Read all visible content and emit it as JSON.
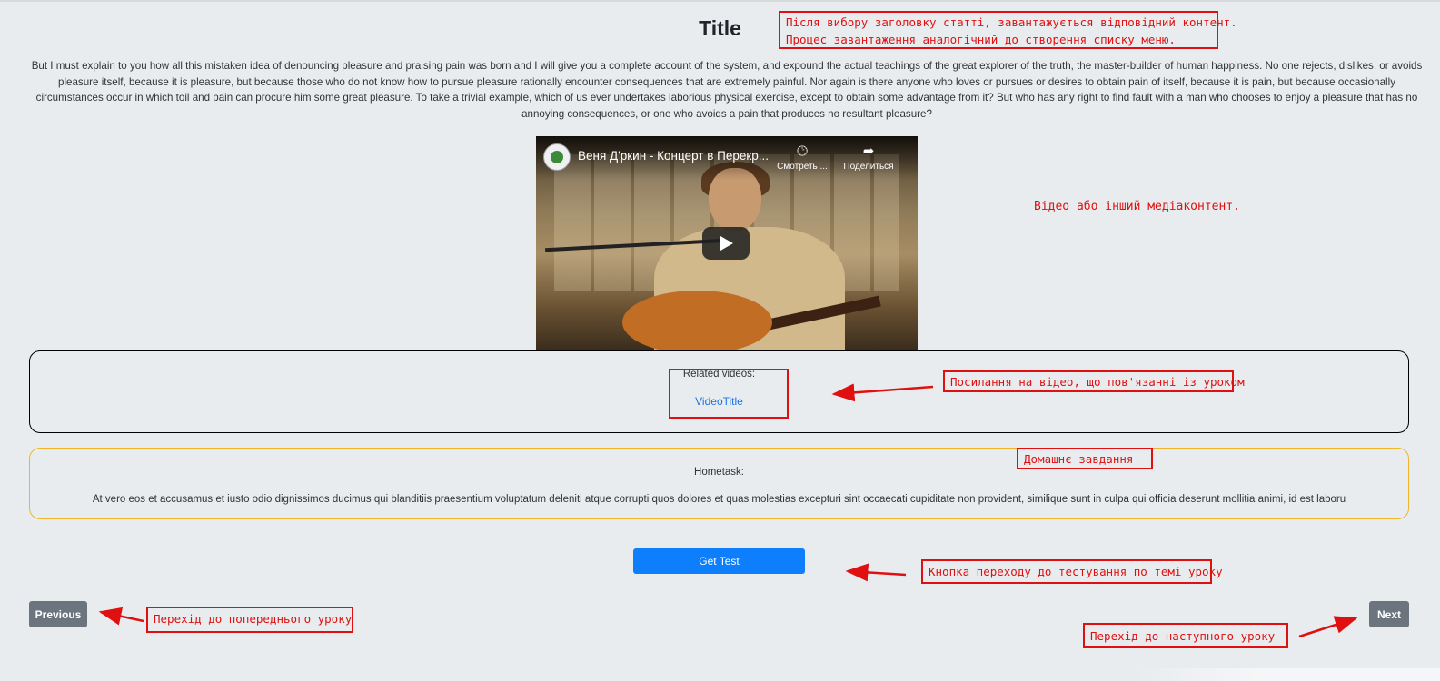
{
  "article": {
    "title": "Title",
    "body": "But I must explain to you how all this mistaken idea of denouncing pleasure and praising pain was born and I will give you a complete account of the system, and expound the actual teachings of the great explorer of the truth, the master-builder of human happiness. No one rejects, dislikes, or avoids pleasure itself, because it is pleasure, but because those who do not know how to pursue pleasure rationally encounter consequences that are extremely painful. Nor again is there anyone who loves or pursues or desires to obtain pain of itself, because it is pain, but because occasionally circumstances occur in which toil and pain can procure him some great pleasure. To take a trivial example, which of us ever undertakes laborious physical exercise, except to obtain some advantage from it? But who has any right to find fault with a man who chooses to enjoy a pleasure that has no annoying consequences, or one who avoids a pain that produces no resultant pleasure?"
  },
  "video": {
    "title": "Веня Д'ркин - Концерт в Перекр...",
    "watch_later_label": "Смотреть ...",
    "share_label": "Поделиться",
    "icons": [
      "clock-icon",
      "share-icon",
      "play-icon"
    ]
  },
  "related": {
    "label": "Related videos:",
    "link": "VideoTitle",
    "border_color": "#000000"
  },
  "hometask": {
    "label": "Hometask:",
    "text": "At vero eos et accusamus et iusto odio dignissimos ducimus qui blanditiis praesentium voluptatum deleniti atque corrupti quos dolores et quas molestias excepturi sint occaecati cupiditate non provident, similique sunt in culpa qui officia deserunt mollitia animi, id est laboru",
    "border_color": "#f0b429"
  },
  "buttons": {
    "get_test": "Get Test",
    "previous": "Previous",
    "next": "Next"
  },
  "annotations": {
    "title_note_line1": "Після вибору заголовку статті, завантажується відповідний контент.",
    "title_note_line2": "Процес завантаження аналогічний до створення списку меню.",
    "media_note": "Відео або інший медіаконтент.",
    "related_note": "Посилання на відео, що пов'язанні із уроком",
    "hometask_note": "Домашнє завдання",
    "test_note": "Кнопка переходу до тестування по темі уроку",
    "prev_note": "Перехід до попереднього уроку",
    "next_note": "Перехід до наступного уроку",
    "color": "#e01010"
  },
  "colors": {
    "background": "#e9ecef",
    "primary_button": "#0d7efc",
    "secondary_button": "#6c757d",
    "link": "#1a73e8"
  }
}
